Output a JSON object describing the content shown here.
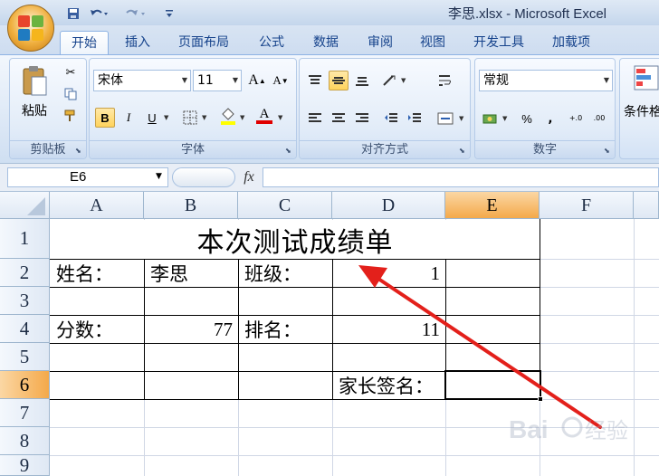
{
  "window": {
    "title": "李思.xlsx - Microsoft Excel"
  },
  "qat": {
    "save_icon": "save-icon",
    "undo_icon": "undo-icon",
    "redo_icon": "redo-icon",
    "customize_icon": "customize-qat-icon"
  },
  "tabs": [
    "开始",
    "插入",
    "页面布局",
    "公式",
    "数据",
    "审阅",
    "视图",
    "开发工具",
    "加载项"
  ],
  "active_tab": "开始",
  "ribbon": {
    "clipboard": {
      "label": "剪贴板",
      "paste": "粘贴"
    },
    "font": {
      "label": "字体",
      "font_name": "宋体",
      "font_size": "11",
      "bold": "B",
      "italic": "I",
      "underline": "U",
      "grow": "A",
      "shrink": "A",
      "font_color": "A"
    },
    "alignment": {
      "label": "对齐方式"
    },
    "number": {
      "label": "数字",
      "format": "常规",
      "percent": "%",
      "comma": ",",
      "inc_decimal": "+.0",
      "dec_decimal": ".00"
    },
    "styles": {
      "partial_label": "条件格"
    }
  },
  "formula_bar": {
    "name_box": "E6",
    "fx": "fx",
    "content": ""
  },
  "columns": [
    "A",
    "B",
    "C",
    "D",
    "E",
    "F"
  ],
  "selected_column": "E",
  "rows": [
    "1",
    "2",
    "3",
    "4",
    "5",
    "6",
    "7",
    "8",
    "9"
  ],
  "selected_row": "6",
  "cells": {
    "title": "本次测试成绩单",
    "A2": "姓名：",
    "B2": "李思",
    "C2": "班级：",
    "D2": "1",
    "A4": "分数：",
    "B4": "77",
    "C4": "排名：",
    "D4": "11",
    "D6": "家长签名："
  },
  "colors": {
    "annotation_arrow": "#e3201b",
    "selection_header": "#f4a94a",
    "ribbon_blue": "#15428b"
  }
}
